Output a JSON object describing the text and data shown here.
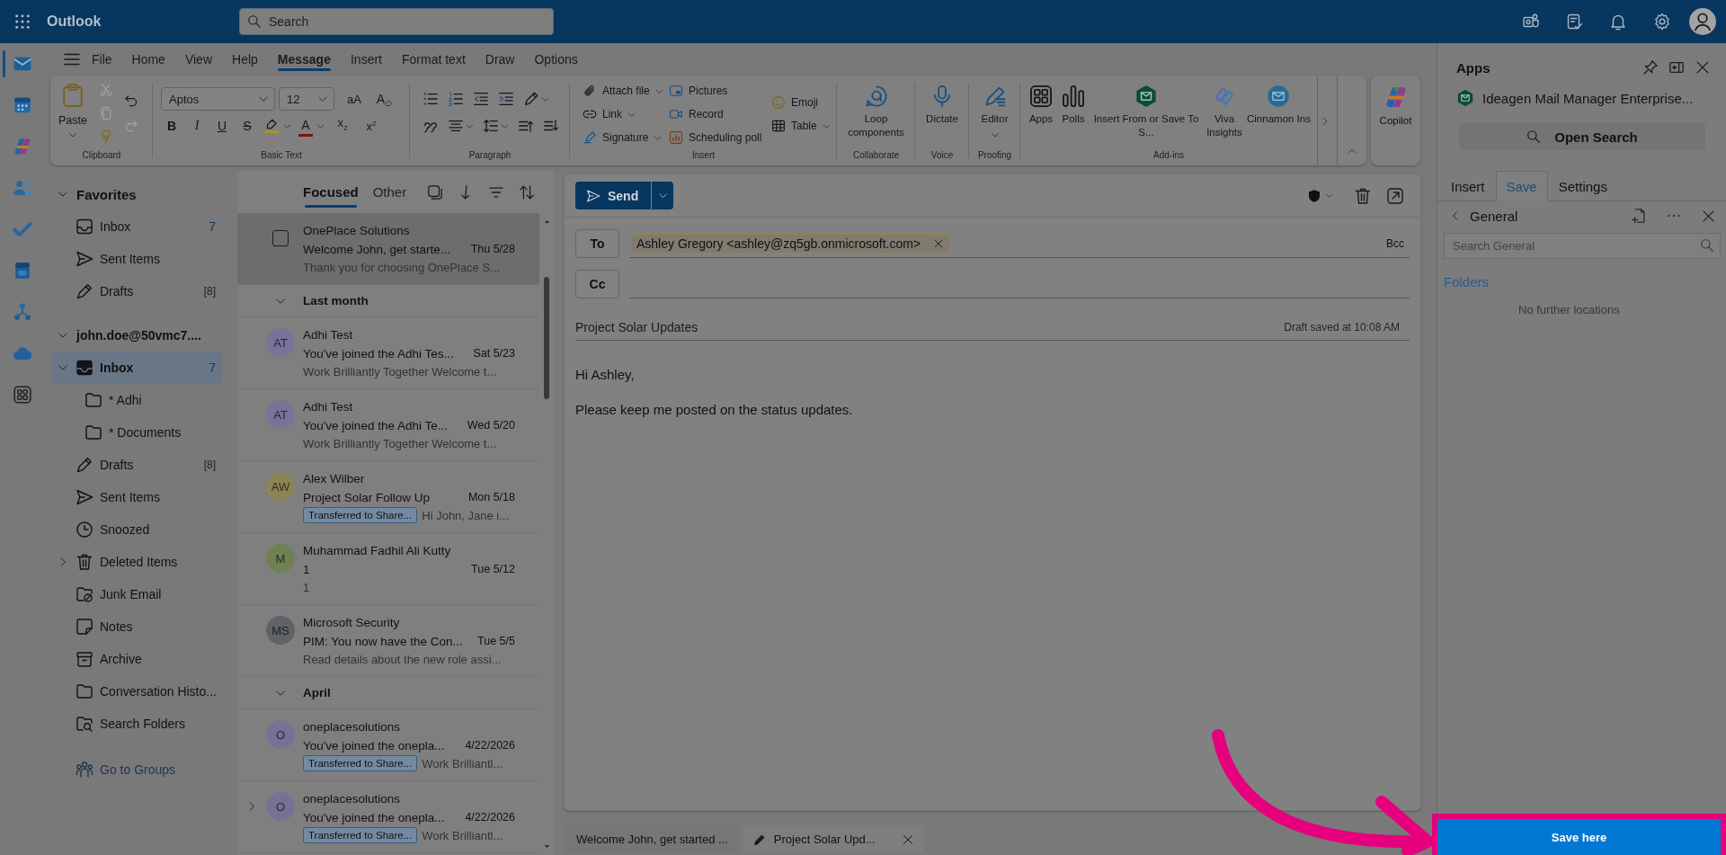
{
  "top_bar": {
    "app_name": "Outlook",
    "search": {
      "placeholder": "Search"
    }
  },
  "nav_rail": [
    {
      "selected": true
    },
    {
      "selected": false
    },
    {
      "selected": false
    },
    {
      "selected": false
    },
    {
      "selected": false
    },
    {
      "selected": false
    },
    {
      "selected": false
    },
    {
      "selected": false
    },
    {
      "selected": false
    }
  ],
  "ribbon": {
    "tabs": [
      {
        "label": "File",
        "selected": false
      },
      {
        "label": "Home",
        "selected": false
      },
      {
        "label": "View",
        "selected": false
      },
      {
        "label": "Help",
        "selected": false
      },
      {
        "label": "Message",
        "selected": true
      },
      {
        "label": "Insert",
        "selected": false
      },
      {
        "label": "Format text",
        "selected": false
      },
      {
        "label": "Draw",
        "selected": false
      },
      {
        "label": "Options",
        "selected": false
      }
    ],
    "clipboard": {
      "label": "Clipboard",
      "paste": "Paste",
      "tools": [
        {
          "disabled": true
        },
        {
          "disabled": true
        },
        {
          "disabled": false
        }
      ],
      "history": [
        {
          "disabled": false
        },
        {
          "disabled": true
        }
      ]
    },
    "basic_text": {
      "label": "Basic Text",
      "font": "Aptos",
      "size": "12",
      "case_button": "aA",
      "clear_button": "A",
      "format_buttons": [
        {
          "text": "B",
          "kind": "bold"
        },
        {
          "text": "I",
          "kind": "italic"
        },
        {
          "text": "U",
          "kind": "underline"
        },
        {
          "text": "S",
          "kind": "strike"
        }
      ],
      "font_color_button": "A",
      "script_buttons": [
        "x$_{2}$",
        "x$^{2}$"
      ]
    },
    "paragraph": {
      "label": "Paragraph"
    },
    "insert": {
      "label": "Insert",
      "items": [
        {
          "label": "Attach file",
          "dropdown": true
        },
        {
          "label": "Link",
          "dropdown": true
        },
        {
          "label": "Signature",
          "dropdown": true
        },
        {
          "label": "Pictures",
          "dropdown": false
        },
        {
          "label": "Record",
          "dropdown": false
        },
        {
          "label": "Scheduling poll",
          "dropdown": false
        },
        {
          "label": "Emoji",
          "dropdown": false
        },
        {
          "label": "Table",
          "dropdown": true
        }
      ]
    },
    "collaborate": {
      "label": "Collaborate",
      "button": "Loop components"
    },
    "voice": {
      "label": "Voice",
      "button": "Dictate"
    },
    "proofing": {
      "label": "Proofing",
      "button": "Editor",
      "dropdown": true
    },
    "add_ins": {
      "label": "Add-ins",
      "buttons": [
        "Apps",
        "Polls",
        "Insert From or Save To S...",
        "Viva Insights",
        "Cinnamon Ins"
      ]
    },
    "copilot": "Copilot"
  },
  "folder_pane": {
    "favorites": {
      "label": "Favorites",
      "expanded": true,
      "items": [
        {
          "label": "Inbox",
          "kind": "inbox",
          "count": "7",
          "unread": true,
          "selected": false
        },
        {
          "label": "Sent Items",
          "kind": "sent",
          "selected": false
        },
        {
          "label": "Drafts",
          "kind": "drafts",
          "count": "[8]",
          "unread": false,
          "selected": false
        }
      ]
    },
    "account": {
      "label": "john.doe@50vmc7....",
      "expanded": true,
      "folders": [
        {
          "label": "Inbox",
          "kind": "inbox",
          "count": "7",
          "unread": true,
          "selected": true,
          "expanded": true,
          "children": [
            {
              "label": "* Adhi",
              "kind": "folder",
              "selected": false
            },
            {
              "label": "* Documents",
              "kind": "folder",
              "selected": false
            }
          ]
        },
        {
          "label": "Drafts",
          "kind": "drafts",
          "count": "[8]",
          "unread": false,
          "selected": false
        },
        {
          "label": "Sent Items",
          "kind": "sent",
          "selected": false
        },
        {
          "label": "Snoozed",
          "kind": "snoozed",
          "selected": false
        },
        {
          "label": "Deleted Items",
          "kind": "deleted",
          "selected": false,
          "expanded": false
        },
        {
          "label": "Junk Email",
          "kind": "junk",
          "selected": false
        },
        {
          "label": "Notes",
          "kind": "notes",
          "selected": false
        },
        {
          "label": "Archive",
          "kind": "archive",
          "selected": false
        },
        {
          "label": "Conversation Histo...",
          "kind": "folder",
          "selected": false
        },
        {
          "label": "Search Folders",
          "kind": "search_folder",
          "selected": false
        }
      ]
    },
    "groups_link": "Go to Groups"
  },
  "message_list": {
    "tabs": [
      {
        "label": "Focused",
        "selected": true
      },
      {
        "label": "Other",
        "selected": false
      }
    ],
    "items": [
      {
        "kind": "message",
        "sender": "OnePlace Solutions",
        "subject": "Welcome John, get starte...",
        "date": "Thu 5/28",
        "preview": "Thank you for choosing OnePlace S...",
        "selected": true,
        "checked": false
      },
      {
        "kind": "group",
        "label": "Last month",
        "expanded": true
      },
      {
        "kind": "message",
        "initials": "AT",
        "color": "#7a7298",
        "sender": "Adhi Test",
        "subject": "You've joined the Adhi Tes...",
        "date": "Sat 5/23",
        "preview": "Work Brilliantly Together Welcome t...",
        "selected": false
      },
      {
        "kind": "message",
        "initials": "AT",
        "color": "#7a7298",
        "sender": "Adhi Test",
        "subject": "You've joined the Adhi Te...",
        "date": "Wed 5/20",
        "preview": "Work Brilliantly Together Welcome t...",
        "selected": false
      },
      {
        "kind": "message",
        "initials": "AW",
        "color": "#8c8455",
        "sender": "Alex Wilber",
        "subject": "Project Solar Follow Up",
        "date": "Mon 5/18",
        "tag": "Transferred to Share...",
        "preview": "Hi John, Jane i...",
        "selected": false
      },
      {
        "kind": "message",
        "initials": "M",
        "color": "#6f8150",
        "sender": "Muhammad Fadhil Ali Kutty",
        "subject": "1",
        "date": "Tue 5/12",
        "preview": "1",
        "selected": false
      },
      {
        "kind": "message",
        "initials": "MS",
        "color": "#5f6266",
        "sender": "Microsoft Security",
        "subject": "PIM: You now have the Con...",
        "date": "Tue 5/5",
        "preview": "Read details about the new role assi...",
        "selected": false
      },
      {
        "kind": "group",
        "label": "April",
        "expanded": true
      },
      {
        "kind": "message",
        "initials": "O",
        "color": "#787196",
        "sender": "oneplacesolutions",
        "subject": "You've joined the onepla...",
        "date": "4/22/2026",
        "tag": "Transferred to Share...",
        "preview": "Work Brilliantl...",
        "selected": false
      },
      {
        "kind": "message",
        "initials": "O",
        "color": "#787196",
        "sender": "oneplacesolutions",
        "subject": "You've joined the onepla...",
        "date": "4/22/2026",
        "tag": "Transferred to Share...",
        "preview": "Work Brilliantl...",
        "selected": false,
        "expanded": false
      }
    ]
  },
  "compose": {
    "send": "Send",
    "to_label": "To",
    "recipients": [
      "Ashley Gregory <ashley@zq5gb.onmicrosoft.com>"
    ],
    "bcc": "Bcc",
    "cc_label": "Cc",
    "subject": "Project Solar Updates",
    "draft_status": "Draft saved at 10:08 AM",
    "body": [
      "Hi Ashley,",
      "Please keep me posted on the status updates."
    ]
  },
  "compose_tabs": [
    {
      "label": "Welcome John, get started ...",
      "kind": "message",
      "selected": false
    },
    {
      "label": "Project Solar Upd...",
      "kind": "draft",
      "selected": true
    }
  ],
  "apps_panel": {
    "title": "Apps",
    "add_in": "Ideagen Mail Manager Enterprise...",
    "open_search": "Open Search",
    "tabs": [
      {
        "label": "Insert",
        "selected": false
      },
      {
        "label": "Save",
        "selected": true
      },
      {
        "label": "Settings",
        "selected": false
      }
    ],
    "location": "General",
    "search": {
      "placeholder": "Search General"
    },
    "folders_heading": "Folders",
    "empty_message": "No further locations",
    "save_button": {
      "label": "Save here",
      "highlighted": true
    }
  }
}
